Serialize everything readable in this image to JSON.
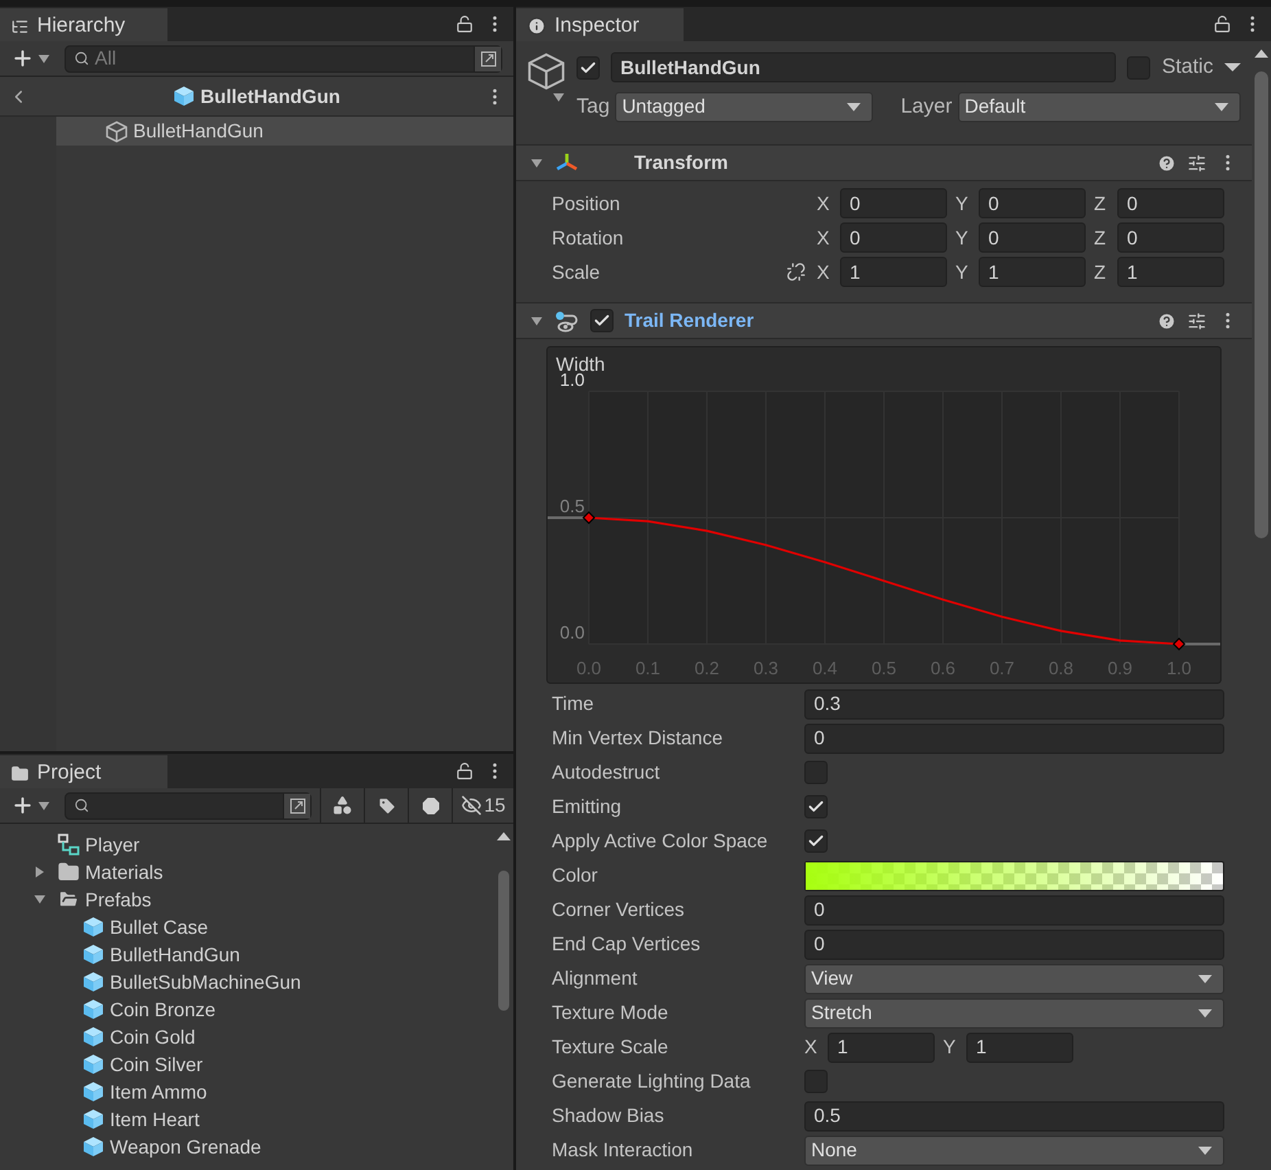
{
  "hierarchy": {
    "tab": "Hierarchy",
    "search": {
      "placeholder": "All"
    },
    "breadcrumb": "BulletHandGun",
    "items": [
      {
        "label": "BulletHandGun",
        "selected": true
      }
    ]
  },
  "project": {
    "tab": "Project",
    "hidden_count": "15",
    "tree": [
      {
        "label": "Player",
        "kind": "animator"
      },
      {
        "label": "Materials",
        "kind": "folder",
        "expanded": false
      },
      {
        "label": "Prefabs",
        "kind": "folder",
        "expanded": true,
        "children": [
          {
            "label": "Bullet Case",
            "kind": "prefab"
          },
          {
            "label": "BulletHandGun",
            "kind": "prefab"
          },
          {
            "label": "BulletSubMachineGun",
            "kind": "prefab"
          },
          {
            "label": "Coin Bronze",
            "kind": "prefab"
          },
          {
            "label": "Coin Gold",
            "kind": "prefab"
          },
          {
            "label": "Coin Silver",
            "kind": "prefab"
          },
          {
            "label": "Item Ammo",
            "kind": "prefab"
          },
          {
            "label": "Item Heart",
            "kind": "prefab"
          },
          {
            "label": "Weapon Grenade",
            "kind": "prefab"
          }
        ]
      }
    ]
  },
  "inspector": {
    "tab": "Inspector",
    "object": {
      "active": true,
      "name": "BulletHandGun",
      "static_label": "Static",
      "static": false,
      "tag_label": "Tag",
      "tag": "Untagged",
      "layer_label": "Layer",
      "layer": "Default"
    },
    "transform": {
      "title": "Transform",
      "rows": [
        {
          "label": "Position",
          "values": [
            {
              "axis": "X",
              "value": "0"
            },
            {
              "axis": "Y",
              "value": "0"
            },
            {
              "axis": "Z",
              "value": "0"
            }
          ]
        },
        {
          "label": "Rotation",
          "values": [
            {
              "axis": "X",
              "value": "0"
            },
            {
              "axis": "Y",
              "value": "0"
            },
            {
              "axis": "Z",
              "value": "0"
            }
          ]
        },
        {
          "label": "Scale",
          "proportions_linked": false,
          "values": [
            {
              "axis": "X",
              "value": "1"
            },
            {
              "axis": "Y",
              "value": "1"
            },
            {
              "axis": "Z",
              "value": "1"
            }
          ]
        }
      ]
    },
    "trail_renderer": {
      "title": "Trail Renderer",
      "enabled": true,
      "curve": {
        "chart_data": {
          "type": "line",
          "title": "Width",
          "x": [
            0,
            0.1,
            0.2,
            0.3,
            0.4,
            0.5,
            0.6,
            0.7,
            0.8,
            0.9,
            1
          ],
          "series": [
            {
              "color": "#e00000",
              "values": [
                0.5,
                0.486,
                0.448,
                0.392,
                0.324,
                0.25,
                0.176,
                0.108,
                0.052,
                0.014,
                0
              ]
            }
          ],
          "xlim": [
            0,
            1
          ],
          "ylim": [
            0,
            1
          ],
          "grid": true,
          "xticks": [
            {
              "value": 0,
              "label": "0.0"
            },
            0.1,
            0.2,
            0.3,
            0.4,
            0.5,
            0.6,
            0.7,
            0.8,
            0.9,
            {
              "value": 1,
              "label": "1.0"
            }
          ],
          "yticks": [
            {
              "value": 0,
              "label": "0.0"
            },
            0.5,
            {
              "value": 1,
              "label": "1.0"
            }
          ]
        }
      },
      "properties": [
        {
          "label": "Time",
          "kind": "field",
          "value": "0.3"
        },
        {
          "label": "Min Vertex Distance",
          "kind": "field",
          "value": "0"
        },
        {
          "label": "Autodestruct",
          "kind": "checkbox",
          "checked": false
        },
        {
          "label": "Emitting",
          "kind": "checkbox",
          "checked": true
        },
        {
          "label": "Apply Active Color Space",
          "kind": "checkbox",
          "checked": true
        },
        {
          "label": "Color",
          "kind": "gradient"
        },
        {
          "label": "Corner Vertices",
          "kind": "field",
          "value": "0"
        },
        {
          "label": "End Cap Vertices",
          "kind": "field",
          "value": "0"
        },
        {
          "label": "Alignment",
          "kind": "dropdown",
          "value": "View"
        },
        {
          "label": "Texture Mode",
          "kind": "dropdown",
          "value": "Stretch"
        },
        {
          "label": "Texture Scale",
          "kind": "vector",
          "values": [
            {
              "axis": "X",
              "value": "1"
            },
            {
              "axis": "Y",
              "value": "1"
            }
          ]
        },
        {
          "label": "Generate Lighting Data",
          "kind": "checkbox",
          "checked": false
        },
        {
          "label": "Shadow Bias",
          "kind": "field",
          "value": "0.5"
        },
        {
          "label": "Mask Interaction",
          "kind": "dropdown",
          "value": "None"
        }
      ]
    }
  }
}
